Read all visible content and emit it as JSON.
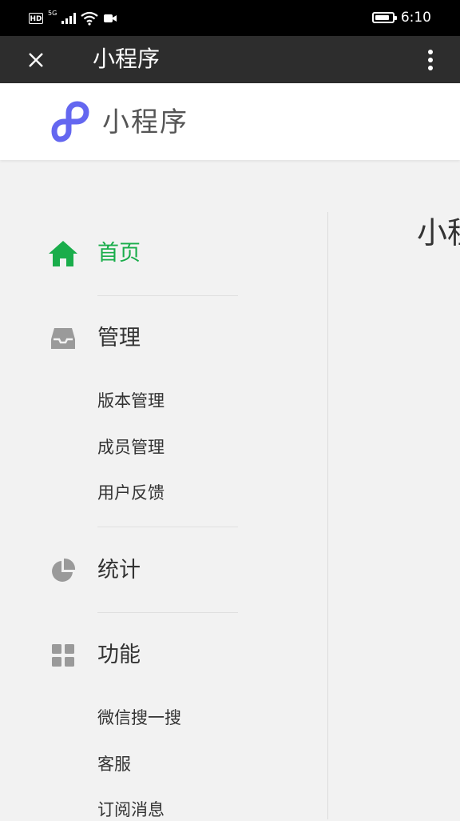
{
  "status_bar": {
    "hd": "HD",
    "network": "5G",
    "time": "6:10",
    "battery_level": 0.85
  },
  "title_bar": {
    "title": "小程序"
  },
  "brand": {
    "name": "小程序",
    "logo_color": "#6467f0"
  },
  "nav": {
    "home": "首页",
    "manage": "管理",
    "manage_items": [
      "版本管理",
      "成员管理",
      "用户反馈"
    ],
    "stats": "统计",
    "features": "功能",
    "feature_items": [
      "微信搜一搜",
      "客服",
      "订阅消息"
    ]
  },
  "content": {
    "title": "小程"
  },
  "colors": {
    "active": "#1aad4b",
    "icon_gray": "#9a9a9a",
    "title_bar_bg": "#2d2d2d"
  }
}
